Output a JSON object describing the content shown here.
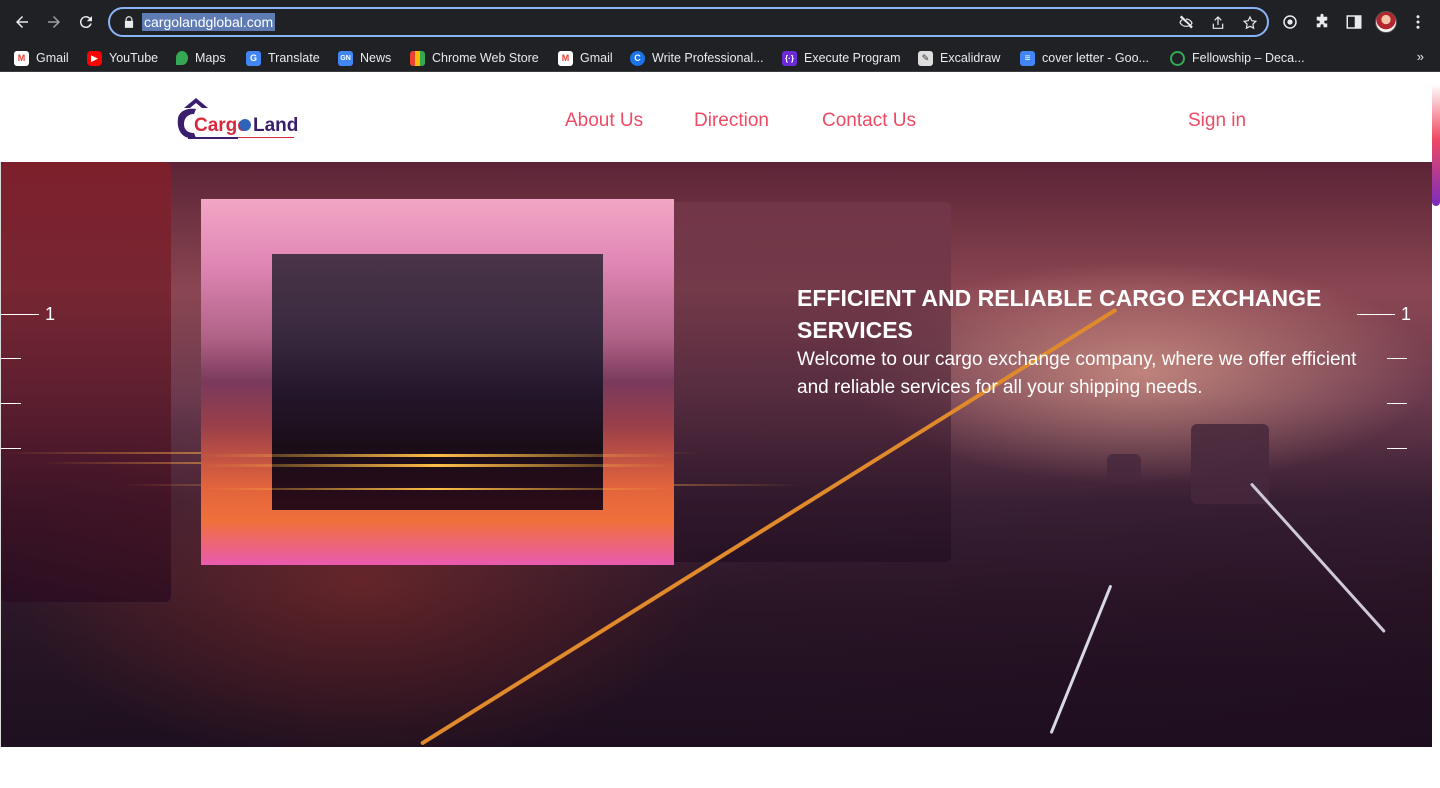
{
  "browser": {
    "url": "cargolandglobal.com",
    "bookmarks": [
      {
        "label": "Gmail",
        "icon": "gmail-icon",
        "color": "#ea4335"
      },
      {
        "label": "YouTube",
        "icon": "youtube-icon",
        "color": "#ff0000"
      },
      {
        "label": "Maps",
        "icon": "maps-icon",
        "color": "#34a853"
      },
      {
        "label": "Translate",
        "icon": "translate-icon",
        "color": "#4285f4"
      },
      {
        "label": "News",
        "icon": "news-icon",
        "color": "#4285f4"
      },
      {
        "label": "Chrome Web Store",
        "icon": "webstore-icon",
        "color": "#ea4335"
      },
      {
        "label": "Gmail",
        "icon": "gmail-icon",
        "color": "#ea4335"
      },
      {
        "label": "Write Professional...",
        "icon": "write-icon",
        "color": "#1a73e8"
      },
      {
        "label": "Execute Program",
        "icon": "execute-program-icon",
        "color": "#6c2bd9"
      },
      {
        "label": "Excalidraw",
        "icon": "excalidraw-icon",
        "color": "#dddddd"
      },
      {
        "label": "cover letter - Goo...",
        "icon": "google-docs-icon",
        "color": "#4285f4"
      },
      {
        "label": "Fellowship – Deca...",
        "icon": "fellowship-icon",
        "color": "#34a853"
      }
    ],
    "overflow_label": "»"
  },
  "site": {
    "logo_text": "CargoLand",
    "logo_tagline": "exploring possibilities",
    "nav": {
      "about": "About Us",
      "direction": "Direction",
      "contact": "Contact Us",
      "signin": "Sign in"
    },
    "accent_color": "#ef4a63",
    "hero": {
      "title": "EFFICIENT AND RELIABLE CARGO EXCHANGE SERVICES",
      "subtitle": "Welcome to our cargo exchange company, where we offer efficient and reliable services for all your shipping needs.",
      "slide_left_number": "1",
      "slide_right_number": "1"
    }
  }
}
